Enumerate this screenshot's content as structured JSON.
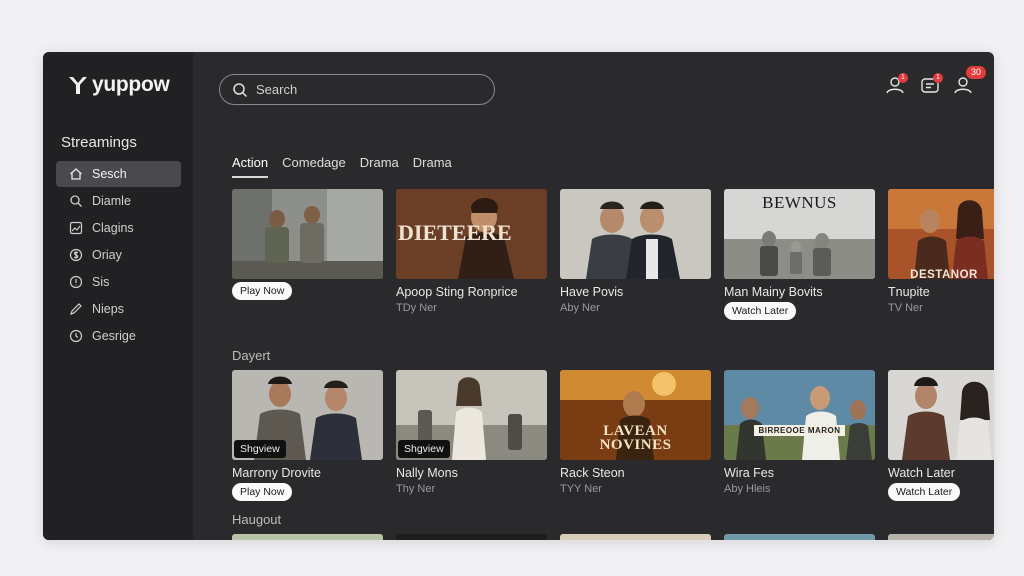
{
  "app": {
    "name": "yuppow"
  },
  "sidebar": {
    "heading": "Streamings",
    "items": [
      {
        "label": "Sesch",
        "icon": "home-icon",
        "active": true
      },
      {
        "label": "Diamle",
        "icon": "search-icon",
        "active": false
      },
      {
        "label": "Clagins",
        "icon": "image-icon",
        "active": false
      },
      {
        "label": "Oriay",
        "icon": "dollar-circle-icon",
        "active": false
      },
      {
        "label": "Sis",
        "icon": "alert-circle-icon",
        "active": false
      },
      {
        "label": "Nieps",
        "icon": "pencil-icon",
        "active": false
      },
      {
        "label": "Gesrige",
        "icon": "clock-icon",
        "active": false
      }
    ]
  },
  "search": {
    "placeholder": "Search"
  },
  "header": {
    "icons": [
      {
        "name": "profile-icon",
        "badge": "1"
      },
      {
        "name": "messages-icon",
        "badge": "1"
      },
      {
        "name": "account-icon",
        "badge": "30"
      }
    ]
  },
  "tabs": [
    {
      "label": "Action",
      "active": true
    },
    {
      "label": "Comedage",
      "active": false
    },
    {
      "label": "Drama",
      "active": false
    },
    {
      "label": "Drama",
      "active": false
    }
  ],
  "rows": [
    {
      "label": "",
      "cards": [
        {
          "title": "",
          "sub": "",
          "button": "Play Now",
          "tag": "",
          "overlay": ""
        },
        {
          "title": "Apoop Sting Ronprice",
          "sub": "TDy Ner",
          "button": "",
          "tag": "",
          "overlay": "DIETEERE"
        },
        {
          "title": "Have Povis",
          "sub": "Aby Ner",
          "button": "",
          "tag": "",
          "overlay": ""
        },
        {
          "title": "Man Mainy Bovits",
          "sub": "",
          "button": "Watch Later",
          "tag": "",
          "overlay": "BEWNUS"
        },
        {
          "title": "Tnupite",
          "sub": "TV Ner",
          "button": "",
          "tag": "",
          "overlay": "DESTANOR"
        }
      ]
    },
    {
      "label": "Dayert",
      "cards": [
        {
          "title": "Marrony Drovite",
          "sub": "",
          "button": "Play Now",
          "tag": "Shgview",
          "overlay": ""
        },
        {
          "title": "Nally Mons",
          "sub": "Thy Ner",
          "button": "",
          "tag": "Shgview",
          "overlay": ""
        },
        {
          "title": "Rack Steon",
          "sub": "TYY Ner",
          "button": "",
          "tag": "",
          "overlay": "LAVEAN NOVINES"
        },
        {
          "title": "Wira Fes",
          "sub": "Aby Hleis",
          "button": "",
          "tag": "",
          "overlay": "BIRREOOE MARON"
        },
        {
          "title": "Watch Later",
          "sub": "",
          "button": "Watch Later",
          "tag": "",
          "overlay": ""
        }
      ]
    },
    {
      "label": "Haugout",
      "cards": []
    }
  ]
}
